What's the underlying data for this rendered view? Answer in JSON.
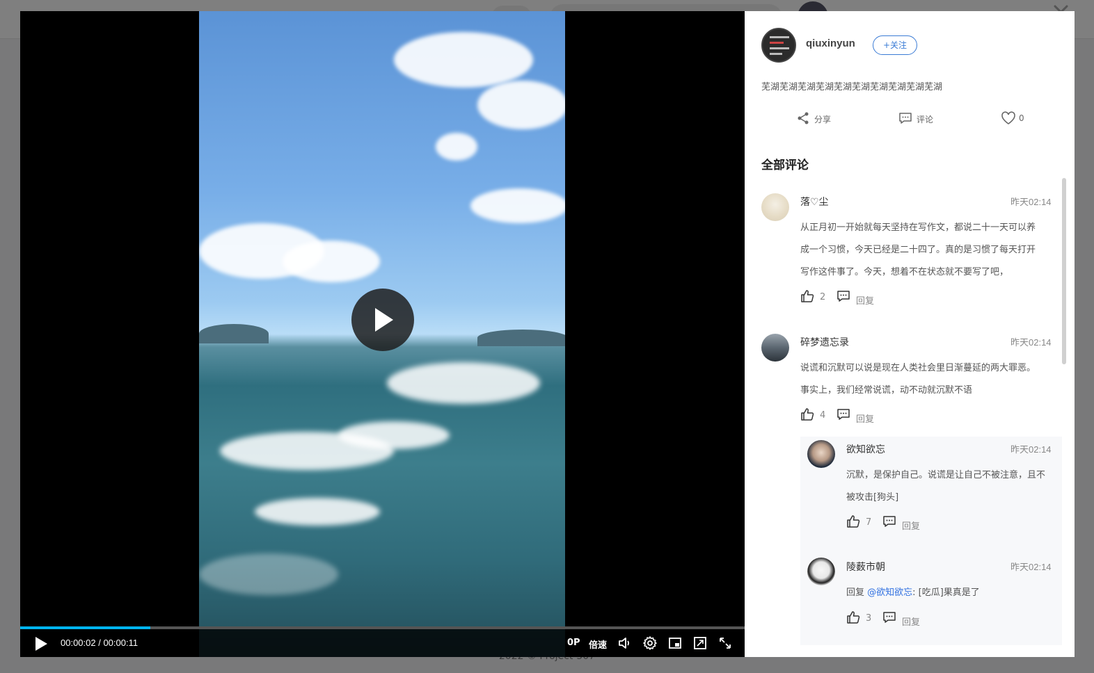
{
  "background": {
    "footer": "2022 © Project-507"
  },
  "player": {
    "current_time": "00:00:02",
    "duration": "00:00:11",
    "progress_fraction": 0.18,
    "quality": "0P",
    "speed_label": "倍速"
  },
  "post": {
    "author": "qiuxinyun",
    "follow_label": "+关注",
    "text": "芜湖芜湖芜湖芜湖芜湖芜湖芜湖芜湖芜湖芜湖",
    "share_label": "分享",
    "comment_label": "评论",
    "like_count": "0"
  },
  "comments_title": "全部评论",
  "comments": [
    {
      "name": "落♡尘",
      "time": "昨天02:14",
      "lines": [
        "从正月初一开始就每天坚持在写作文，都说二十一天可以养",
        "成一个习惯，今天已经是二十四了。真的是习惯了每天打开",
        "写作这件事了。今天，想着不在状态就不要写了吧，"
      ],
      "likes": "2",
      "reply_label": "回复"
    },
    {
      "name": "碎梦遗忘录",
      "time": "昨天02:14",
      "lines": [
        "说谎和沉默可以说是现在人类社会里日渐蔓延的两大罪恶。",
        "事实上，我们经常说谎，动不动就沉默不语"
      ],
      "likes": "4",
      "reply_label": "回复"
    }
  ],
  "replies": [
    {
      "name": "欲知欲忘",
      "time": "昨天02:14",
      "lines": [
        "沉默，是保护自己。说谎是让自己不被注意，且不",
        "被攻击[狗头]"
      ],
      "likes": "7",
      "reply_label": "回复"
    },
    {
      "name": "陵薮市朝",
      "time": "昨天02:14",
      "prefix": "回复 ",
      "mention": "@欲知欲忘",
      "text": ": [吃瓜]果真是了",
      "likes": "3",
      "reply_label": "回复"
    }
  ]
}
